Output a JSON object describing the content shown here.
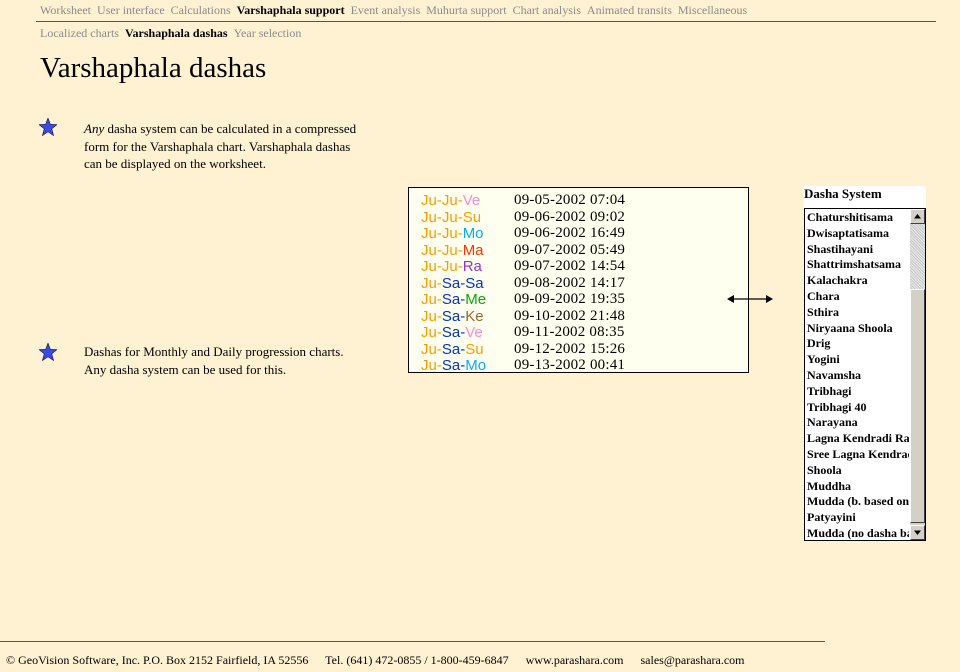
{
  "nav": {
    "items": [
      "Worksheet",
      "User interface",
      "Calculations",
      "Varshaphala support",
      "Event analysis",
      "Muhurta support",
      "Chart analysis",
      "Animated transits",
      "Miscellaneous"
    ],
    "active_index": 3
  },
  "subnav": {
    "items": [
      "Localized charts",
      "Varshaphala dashas",
      "Year selection"
    ],
    "active_index": 1
  },
  "page": {
    "title": "Varshaphala dashas"
  },
  "bullets": [
    {
      "emphasis": "Any",
      "lines": [
        " dasha system can be calculated in a compressed",
        "form for the Varshaphala chart. Varshaphala dashas",
        "can be displayed on the worksheet."
      ]
    },
    {
      "lines": [
        "Dashas for Monthly and Daily progression charts.",
        "Any dasha system can be used for this."
      ]
    }
  ],
  "dasha_rows": [
    {
      "parts": [
        "Ju",
        "Ju",
        "Ve"
      ],
      "date": "09-05-2002 07:04"
    },
    {
      "parts": [
        "Ju",
        "Ju",
        "Su"
      ],
      "date": "09-06-2002 09:02"
    },
    {
      "parts": [
        "Ju",
        "Ju",
        "Mo"
      ],
      "date": "09-06-2002 16:49"
    },
    {
      "parts": [
        "Ju",
        "Ju",
        "Ma"
      ],
      "date": "09-07-2002 05:49"
    },
    {
      "parts": [
        "Ju",
        "Ju",
        "Ra"
      ],
      "date": "09-07-2002 14:54"
    },
    {
      "parts": [
        "Ju",
        "Sa",
        "Sa"
      ],
      "date": "09-08-2002 14:17"
    },
    {
      "parts": [
        "Ju",
        "Sa",
        "Me"
      ],
      "date": "09-09-2002 19:35"
    },
    {
      "parts": [
        "Ju",
        "Sa",
        "Ke"
      ],
      "date": "09-10-2002 21:48"
    },
    {
      "parts": [
        "Ju",
        "Sa",
        "Ve"
      ],
      "date": "09-11-2002 08:35"
    },
    {
      "parts": [
        "Ju",
        "Sa",
        "Su"
      ],
      "date": "09-12-2002 15:26"
    },
    {
      "parts": [
        "Ju",
        "Sa",
        "Mo"
      ],
      "date": "09-13-2002 00:41"
    }
  ],
  "planet_colors": {
    "Ju": "#ff9900",
    "Sa": "#0033cc",
    "Ve": "#ff88cc",
    "Su": "#ff9900",
    "Mo": "#00aaff",
    "Ma": "#ff3300",
    "Ra": "#9933cc",
    "Me": "#00aa00",
    "Ke": "#996633"
  },
  "dasha_system": {
    "title": "Dasha System",
    "options": [
      "Chaturshitisama",
      "Dwisaptatisama",
      "Shastihayani",
      "Shattrimshatsama",
      "Kalachakra",
      "Chara",
      "Sthira",
      "Niryaana Shoola",
      "Drig",
      "Yogini",
      "Navamsha",
      "Tribhagi",
      "Tribhagi 40",
      "Narayana",
      "Lagna Kendradi Rasi",
      "Sree Lagna Kendradi",
      "Shoola",
      "Muddha",
      "Mudda (b. based on",
      "Patyayini",
      "Mudda (no dasha bal"
    ]
  },
  "footer": {
    "company": "© GeoVision Software, Inc. P.O. Box 2152 Fairfield, IA 52556",
    "phone": "Tel. (641) 472-0855 / 1-800-459-6847",
    "website": "www.parashara.com",
    "email": "sales@parashara.com"
  },
  "colors": {
    "background": "#fff2d2",
    "star": "#3a4de0"
  }
}
